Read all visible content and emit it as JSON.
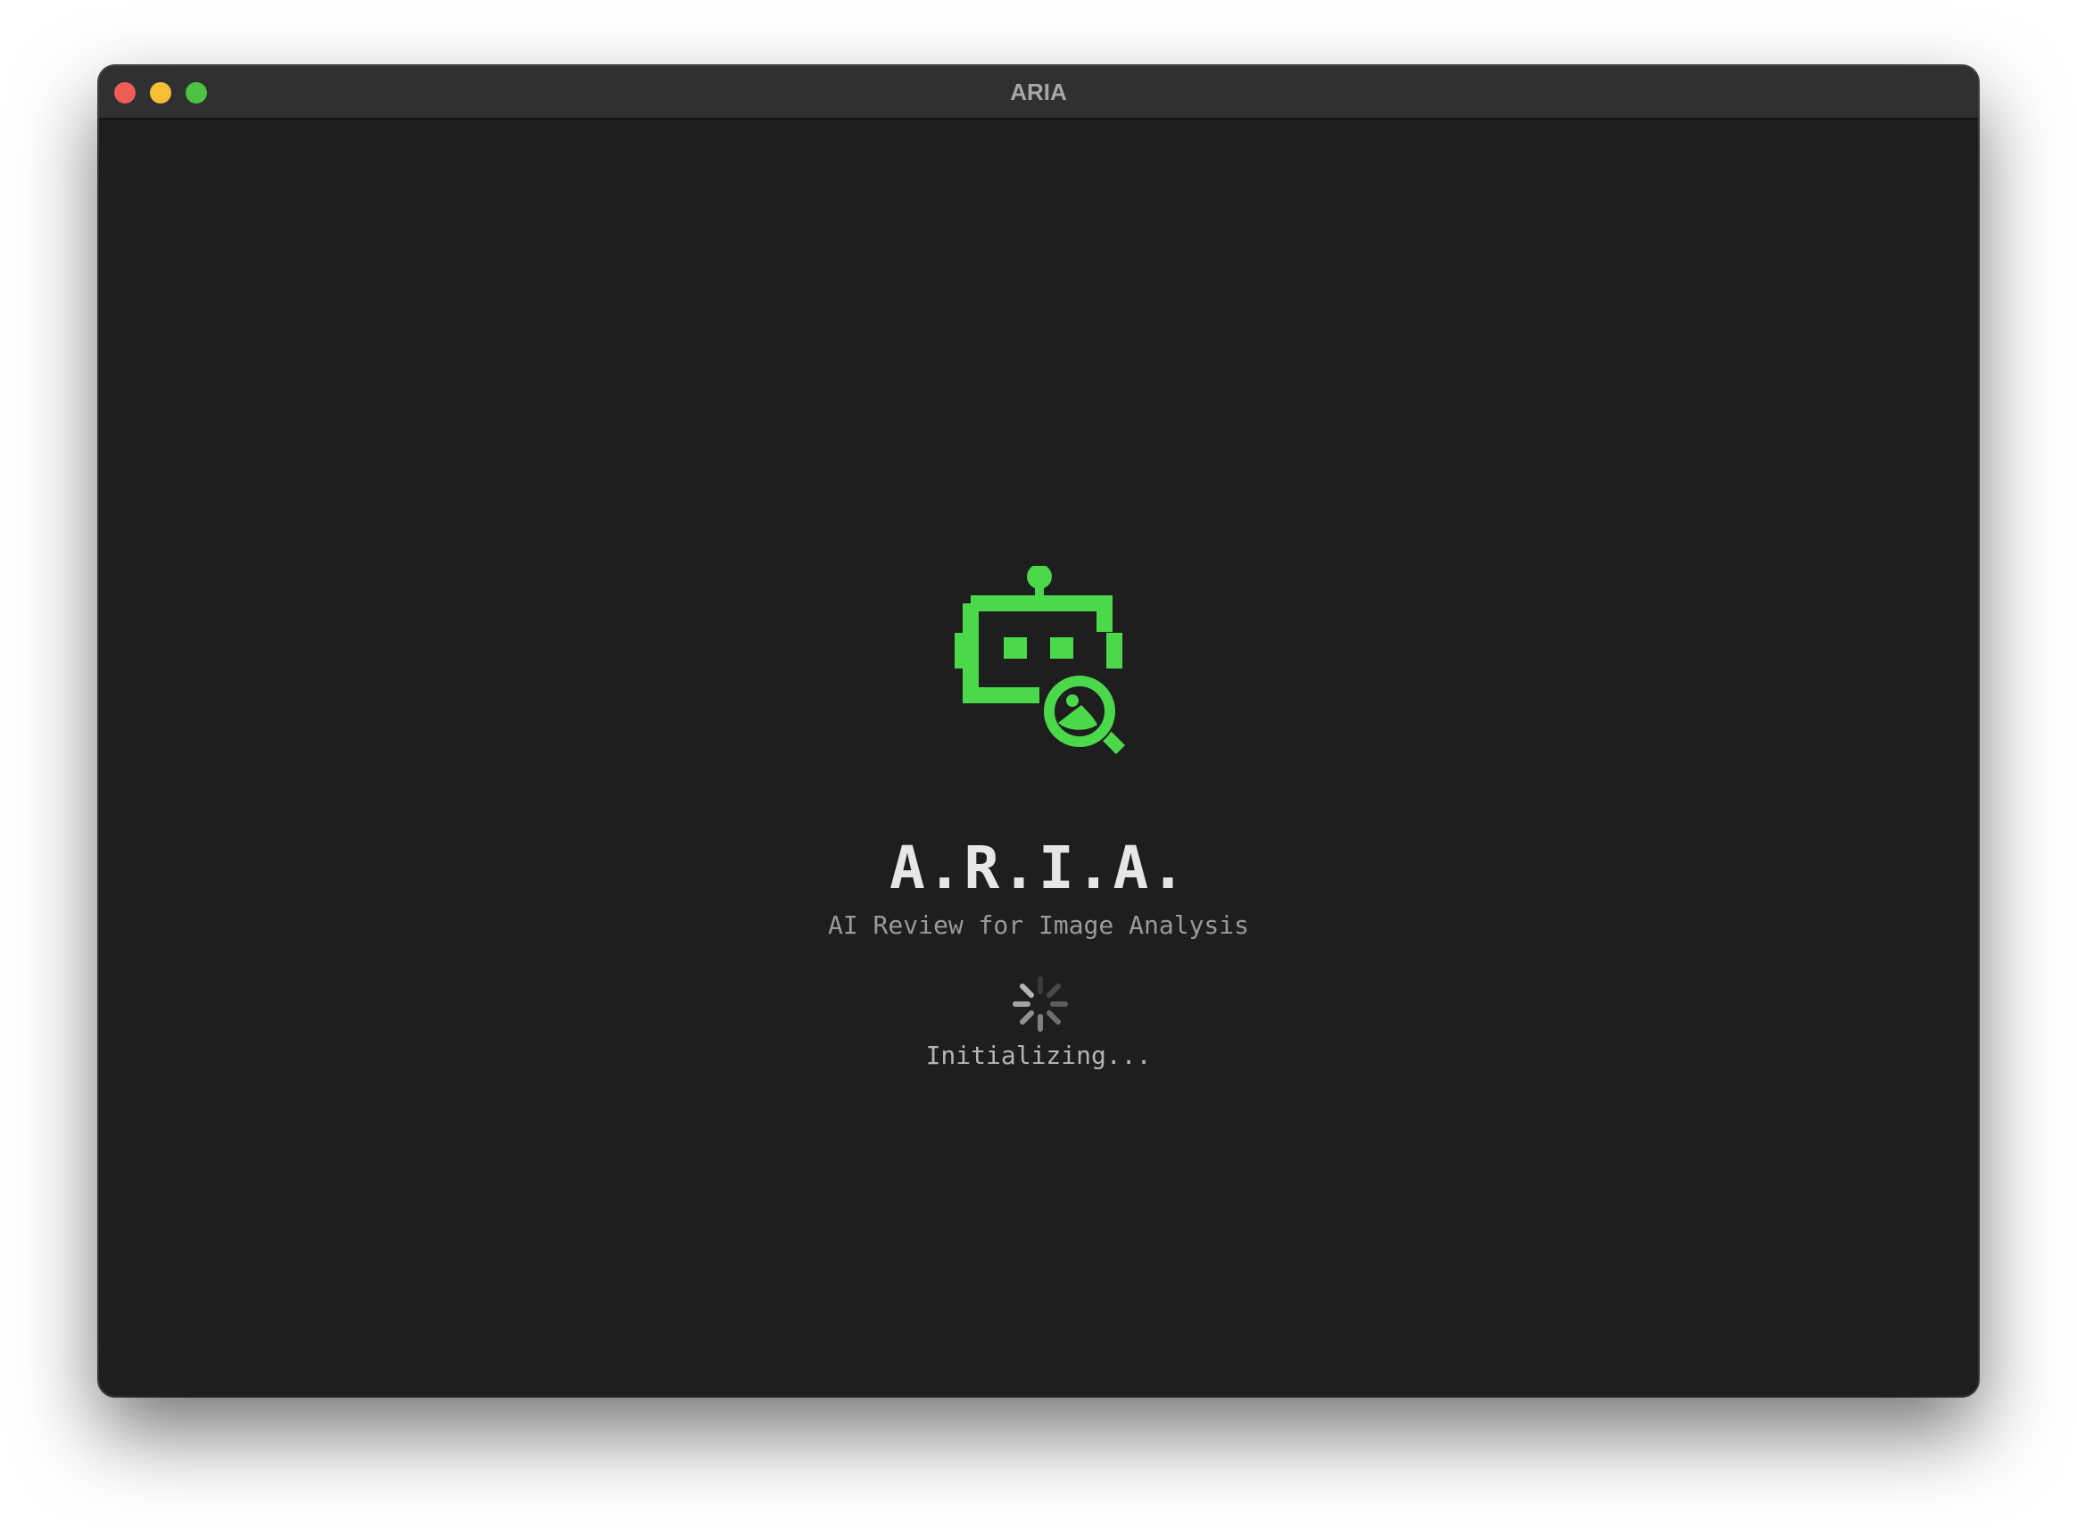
{
  "window": {
    "title": "ARIA"
  },
  "splash": {
    "logo_icon": "robot-magnifier-image-icon",
    "app_name": "A.R.I.A.",
    "tagline": "AI Review for Image Analysis",
    "status": "Initializing...",
    "spinner_icon": "loading-spinner-icon"
  },
  "colors": {
    "accent": "#4bd84b",
    "background": "#1e1e1e",
    "titlebar": "#2f3032"
  }
}
